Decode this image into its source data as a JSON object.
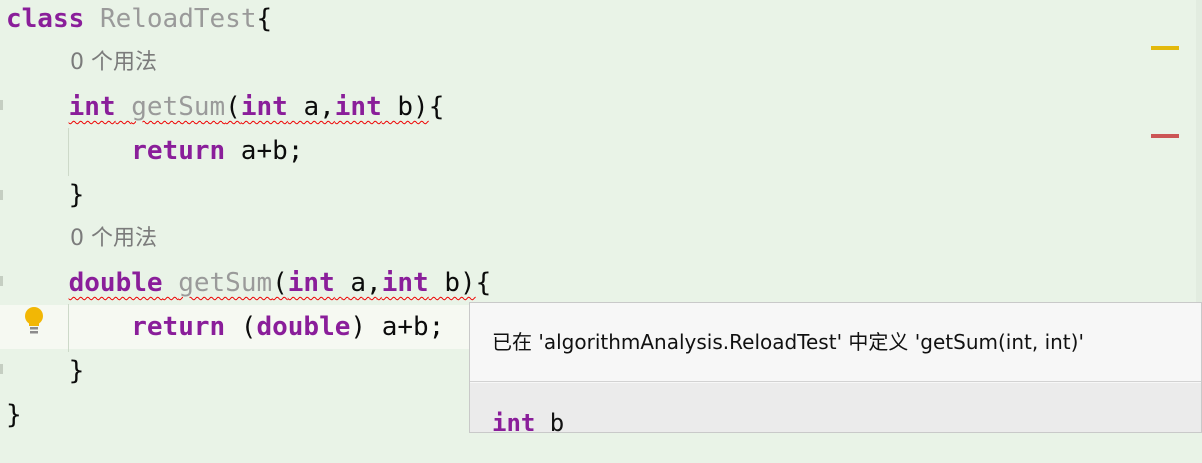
{
  "editor": {
    "lines": [
      {
        "parts": [
          {
            "t": "class",
            "c": "kw"
          },
          {
            "t": " "
          },
          {
            "t": "ReloadTest",
            "c": "gray"
          },
          {
            "t": "{"
          }
        ]
      },
      {
        "hint": "0 个用法"
      },
      {
        "parts": [
          {
            "t": "    "
          },
          {
            "t": "int",
            "c": "kw err"
          },
          {
            "t": " ",
            "c": "err"
          },
          {
            "t": "getSum",
            "c": "gray err"
          },
          {
            "t": "(",
            "c": "err"
          },
          {
            "t": "int",
            "c": "kw err"
          },
          {
            "t": " a,",
            "c": "err"
          },
          {
            "t": "int",
            "c": "kw err"
          },
          {
            "t": " b)",
            "c": "err"
          },
          {
            "t": "{"
          }
        ]
      },
      {
        "parts": [
          {
            "t": "        "
          },
          {
            "t": "return",
            "c": "kw"
          },
          {
            "t": " a+b;"
          }
        ]
      },
      {
        "parts": [
          {
            "t": "    }"
          }
        ]
      },
      {
        "hint": "0 个用法"
      },
      {
        "parts": [
          {
            "t": "    "
          },
          {
            "t": "double",
            "c": "kw err"
          },
          {
            "t": " ",
            "c": "err"
          },
          {
            "t": "getSum",
            "c": "gray err"
          },
          {
            "t": "(",
            "c": "err"
          },
          {
            "t": "int",
            "c": "kw err"
          },
          {
            "t": " a,",
            "c": "err"
          },
          {
            "t": "int",
            "c": "kw err"
          },
          {
            "t": " b)",
            "c": "err"
          },
          {
            "t": "{"
          }
        ]
      },
      {
        "parts": [
          {
            "t": "        "
          },
          {
            "t": "return",
            "c": "kw"
          },
          {
            "t": " ("
          },
          {
            "t": "double",
            "c": "kw"
          },
          {
            "t": ") a+b;"
          }
        ],
        "current": true
      },
      {
        "parts": [
          {
            "t": "    }"
          }
        ]
      },
      {
        "parts": [
          {
            "t": "}"
          }
        ]
      }
    ]
  },
  "popup": {
    "message": "已在 'algorithmAnalysis.ReloadTest' 中定义 'getSum(int, int)'",
    "signature_type": "int",
    "signature_name": " b"
  },
  "colors": {
    "background": "#e9f3e7",
    "keyword": "#8a1e9a",
    "error_underline": "#ee0000",
    "warning_mark": "#e3b90c",
    "error_mark": "#cc5555"
  }
}
